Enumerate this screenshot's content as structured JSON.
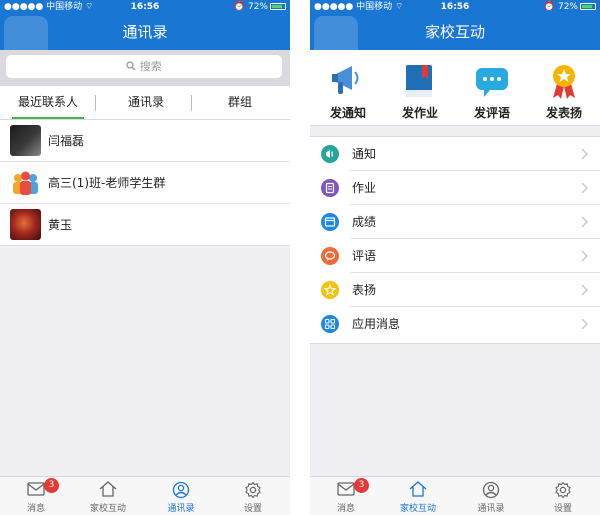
{
  "status_bar": {
    "carrier": "中国移动",
    "time": "16:56",
    "battery": "72%",
    "signal_dots": "●●●●●"
  },
  "left_screen": {
    "title": "通讯录",
    "search": {
      "placeholder": "搜索"
    },
    "tabs": [
      {
        "label": "最近联系人",
        "active": true
      },
      {
        "label": "通讯录",
        "active": false
      },
      {
        "label": "群组",
        "active": false
      }
    ],
    "contacts": [
      {
        "name": "闫福磊"
      },
      {
        "name": "高三(1)班-老师学生群"
      },
      {
        "name": "黄玉"
      }
    ]
  },
  "right_screen": {
    "title": "家校互动",
    "shortcuts": [
      {
        "label": "发通知",
        "icon": "megaphone-icon"
      },
      {
        "label": "发作业",
        "icon": "book-icon"
      },
      {
        "label": "发评语",
        "icon": "chat-bubble-icon"
      },
      {
        "label": "发表扬",
        "icon": "medal-icon"
      }
    ],
    "menu": [
      {
        "label": "通知",
        "icon": "notice-icon",
        "color": "#26a69a"
      },
      {
        "label": "作业",
        "icon": "homework-icon",
        "color": "#7e57c2"
      },
      {
        "label": "成绩",
        "icon": "grades-icon",
        "color": "#1e88e5"
      },
      {
        "label": "评语",
        "icon": "comment-icon",
        "color": "#ef6c3a"
      },
      {
        "label": "表扬",
        "icon": "star-icon",
        "color": "#f4c20d"
      },
      {
        "label": "应用消息",
        "icon": "apps-icon",
        "color": "#1e88e5"
      }
    ]
  },
  "tab_bar": {
    "items": [
      {
        "label": "消息",
        "icon": "mail-icon",
        "badge": "3"
      },
      {
        "label": "家校互动",
        "icon": "home-icon"
      },
      {
        "label": "通讯录",
        "icon": "contacts-icon"
      },
      {
        "label": "设置",
        "icon": "gear-icon"
      }
    ],
    "left_active": 2,
    "right_active": 1
  },
  "colors": {
    "accent": "#1976d2",
    "tab_indicator": "#4caf50",
    "badge": "#e53935",
    "background": "#efeff4"
  }
}
